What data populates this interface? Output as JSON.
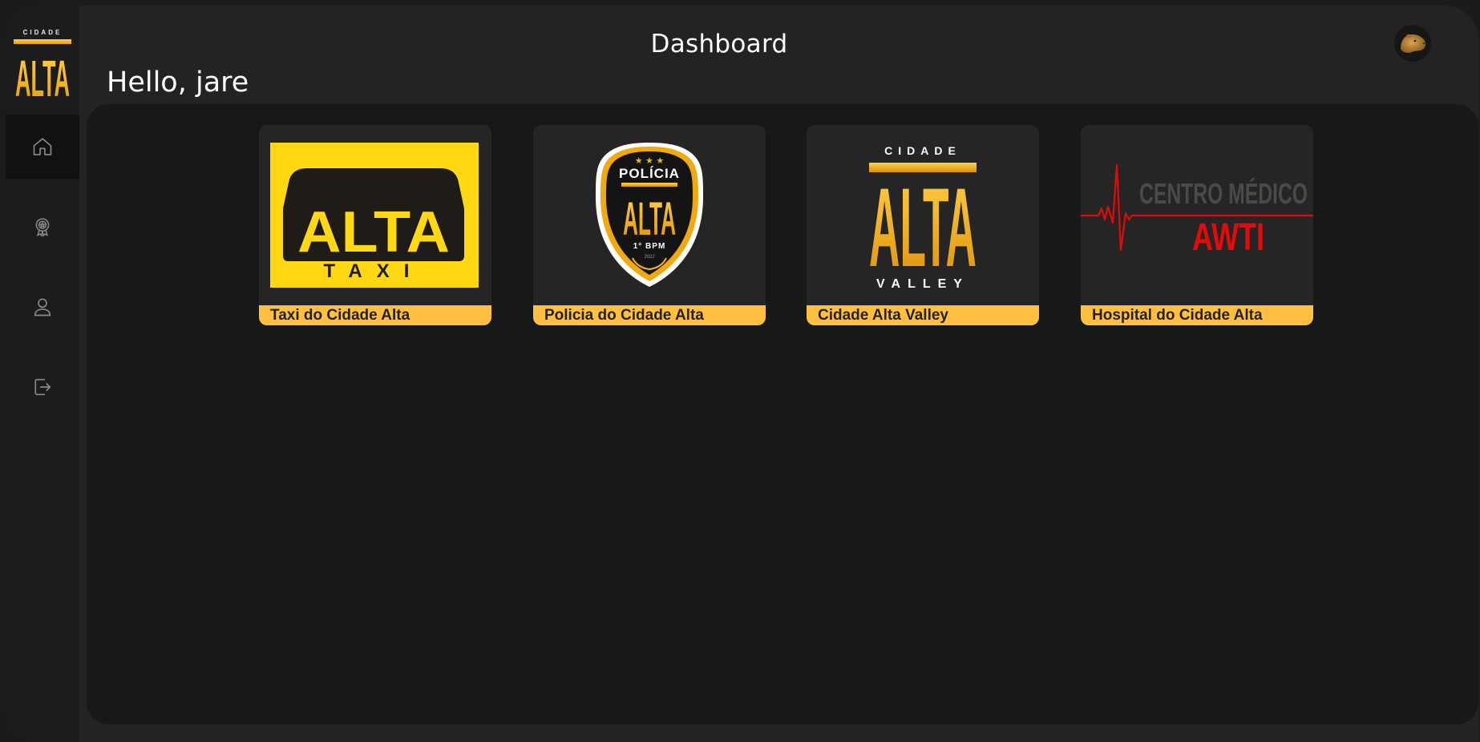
{
  "sidebar": {
    "brand": {
      "top_word": "CIDADE",
      "main_word": "ALTA"
    },
    "items": [
      {
        "icon": "home-icon",
        "active": true
      },
      {
        "icon": "award-icon",
        "active": false
      },
      {
        "icon": "user-icon",
        "active": false
      },
      {
        "icon": "logout-icon",
        "active": false
      }
    ]
  },
  "header": {
    "title": "Dashboard",
    "greeting": "Hello, jare"
  },
  "cards": [
    {
      "label": "Taxi do Cidade Alta",
      "logo": {
        "main": "ALTA",
        "sub": "TAXI"
      }
    },
    {
      "label": "Policia do Cidade Alta",
      "logo": {
        "top": "POLÍCIA",
        "main": "ALTA",
        "sub": "1° BPM",
        "year": "2022"
      }
    },
    {
      "label": "Cidade Alta Valley",
      "logo": {
        "top": "CIDADE",
        "main": "ALTA",
        "sub": "VALLEY"
      }
    },
    {
      "label": "Hospital do Cidade Alta",
      "logo": {
        "top": "CENTRO MÉDICO",
        "main": "AWTI"
      }
    }
  ],
  "colors": {
    "accent": "#ffbf40",
    "gold": "#f4b41a",
    "taxi_yellow": "#ffd814",
    "medical_red": "#e30a0a"
  }
}
